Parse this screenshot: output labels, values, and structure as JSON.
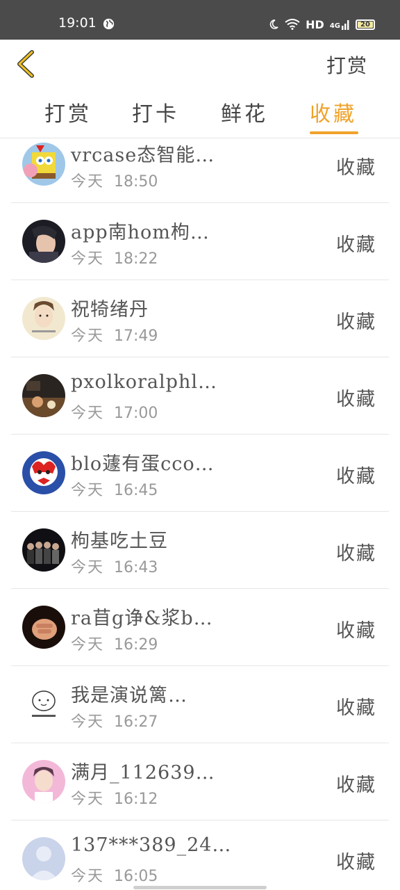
{
  "status_bar": {
    "time": "19:01",
    "network": "HD",
    "signal": "4G",
    "battery": "20"
  },
  "header": {
    "back_icon": "chevron-left-icon",
    "action_label": "打赏"
  },
  "tabs": [
    {
      "label": "打赏",
      "active": false
    },
    {
      "label": "打卡",
      "active": false
    },
    {
      "label": "鲜花",
      "active": false
    },
    {
      "label": "收藏",
      "active": true
    }
  ],
  "colors": {
    "accent": "#f0a22a",
    "back_icon": "#f0c020",
    "status_bar_bg": "#4b4b4b"
  },
  "items": [
    {
      "name": "vrcase态智能…",
      "day": "今天",
      "time": "18:50",
      "action": "收藏"
    },
    {
      "name": "app南hom枸…",
      "day": "今天",
      "time": "18:22",
      "action": "收藏"
    },
    {
      "name": "祝犄绪丹",
      "day": "今天",
      "time": "17:49",
      "action": "收藏"
    },
    {
      "name": "pxolkoralphl…",
      "day": "今天",
      "time": "17:00",
      "action": "收藏"
    },
    {
      "name": "blo蘧有蛋cco…",
      "day": "今天",
      "time": "16:45",
      "action": "收藏"
    },
    {
      "name": "枸基吃土豆",
      "day": "今天",
      "time": "16:43",
      "action": "收藏"
    },
    {
      "name": "ra苜g诤&浆b…",
      "day": "今天",
      "time": "16:29",
      "action": "收藏"
    },
    {
      "name": "我是演说篱…",
      "day": "今天",
      "time": "16:27",
      "action": "收藏"
    },
    {
      "name": "满月_112639…",
      "day": "今天",
      "time": "16:12",
      "action": "收藏"
    },
    {
      "name": "137***389_24…",
      "day": "今天",
      "time": "16:05",
      "action": "收藏"
    }
  ]
}
